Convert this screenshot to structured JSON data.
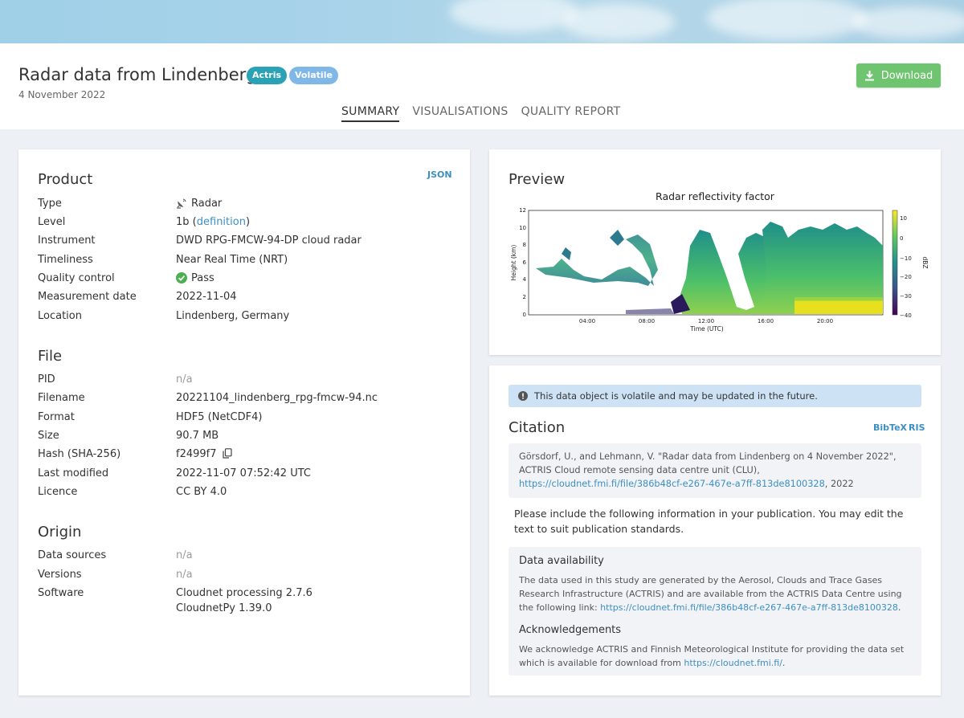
{
  "header": {
    "title": "Radar data from Lindenberg",
    "tags": {
      "actris": "Actris",
      "volatile": "Volatile"
    },
    "date": "4 November 2022",
    "download_label": "Download",
    "tabs": [
      "SUMMARY",
      "VISUALISATIONS",
      "QUALITY REPORT"
    ],
    "active_tab": "SUMMARY"
  },
  "product": {
    "title": "Product",
    "json_link": "JSON",
    "rows": [
      {
        "key": "Type",
        "value": "Radar"
      },
      {
        "key": "Level",
        "value": "1b",
        "link": "definition"
      },
      {
        "key": "Instrument",
        "value": "DWD RPG-FMCW-94-DP cloud radar"
      },
      {
        "key": "Timeliness",
        "value": "Near Real Time (NRT)"
      },
      {
        "key": "Quality control",
        "value": "Pass"
      },
      {
        "key": "Measurement date",
        "value": "2022-11-04"
      },
      {
        "key": "Location",
        "value": "Lindenberg, Germany"
      }
    ]
  },
  "file": {
    "title": "File",
    "rows": [
      {
        "key": "PID",
        "value": "n/a"
      },
      {
        "key": "Filename",
        "value": "20221104_lindenberg_rpg-fmcw-94.nc"
      },
      {
        "key": "Format",
        "value": "HDF5 (NetCDF4)"
      },
      {
        "key": "Size",
        "value": "90.7 MB"
      },
      {
        "key": "Hash (SHA-256)",
        "value": "f2499f7"
      },
      {
        "key": "Last modified",
        "value": "2022-11-07 07:52:42 UTC"
      },
      {
        "key": "Licence",
        "value": "CC BY 4.0"
      }
    ]
  },
  "origin": {
    "title": "Origin",
    "rows": [
      {
        "key": "Data sources",
        "value": "n/a"
      },
      {
        "key": "Versions",
        "value": "n/a"
      },
      {
        "key": "Software",
        "value": "Cloudnet processing 2.7.6",
        "value2": "CloudnetPy 1.39.0"
      }
    ]
  },
  "preview": {
    "title": "Preview",
    "plot_title": "Radar reflectivity factor",
    "ylabel": "Height (km)",
    "xlabel": "Time (UTC)",
    "yticks": [
      "12",
      "10",
      "8",
      "6",
      "4",
      "2",
      "0"
    ],
    "xticks": [
      "04:00",
      "08:00",
      "12:00",
      "16:00",
      "20:00"
    ],
    "cbar_ticks": [
      "10",
      "0",
      "−10",
      "−20",
      "−30",
      "−40"
    ],
    "cbar_label": "dBZ"
  },
  "citation": {
    "alert": "This data object is volatile and may be updated in the future.",
    "title": "Citation",
    "bibtex": "BibTeX",
    "ris": "RIS",
    "text_pre": "Görsdorf, U., and Lehmann, V. \"Radar data from Lindenberg on 4 November 2022\", ACTRIS Cloud remote sensing data centre unit (CLU), ",
    "text_link": "https://cloudnet.fmi.fi/file/386b48cf-e267-467e-a7ff-813de8100328",
    "text_post": ", 2022",
    "para": "Please include the following information in your publication. You may edit the text to suit publication standards.",
    "availability_title": "Data availability",
    "availability_text": "The data used in this study are generated by the Aerosol, Clouds and Trace Gases Research Infrastructure (ACTRIS) and are available from the ACTRIS Data Centre using the following link: ",
    "availability_link": "https://cloudnet.fmi.fi/file/386b48cf-e267-467e-a7ff-813de8100328",
    "availability_end": ".",
    "ack_title": "Acknowledgements",
    "ack_text": "We acknowledge ACTRIS and Finnish Meteorological Institute for providing the data set which is available for download from ",
    "ack_link": "https://cloudnet.fmi.fi/",
    "ack_end": "."
  },
  "colors": {
    "accent_link": "#3d8fc2",
    "download_green": "#6fc46f",
    "actris_tag": "#2aa2b5",
    "volatile_tag": "#7fb8e8"
  }
}
